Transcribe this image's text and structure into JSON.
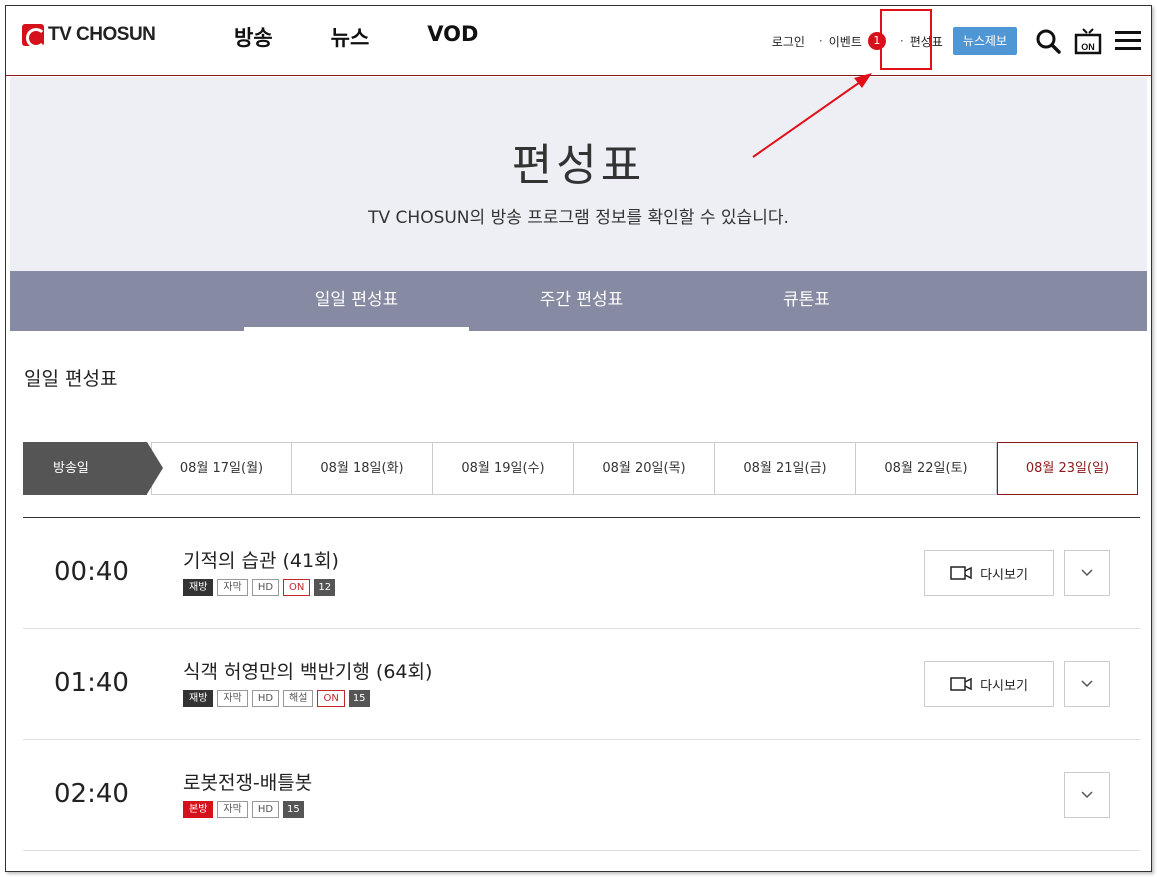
{
  "header": {
    "logo_text": "TV CHOSUN",
    "nav": [
      "방송",
      "뉴스",
      "VOD"
    ],
    "login": "로그인",
    "event": "이벤트",
    "event_count": "1",
    "schedule": "편성표",
    "news_tip": "뉴스제보",
    "on_icon_label": "ON"
  },
  "hero": {
    "title": "편성표",
    "description": "TV CHOSUN의 방송 프로그램 정보를 확인할 수 있습니다."
  },
  "tabs": [
    "일일 편성표",
    "주간 편성표",
    "큐톤표"
  ],
  "section_title": "일일 편성표",
  "datebar": {
    "label": "방송일",
    "dates": [
      "08월 17일(월)",
      "08월 18일(화)",
      "08월 19일(수)",
      "08월 20일(목)",
      "08월 21일(금)",
      "08월 22일(토)",
      "08월 23일(일)"
    ],
    "selected_index": 6
  },
  "programs": [
    {
      "time": "00:40",
      "title": "기적의 습관 (41회)",
      "tags": [
        "재방",
        "자막",
        "HD",
        "ON",
        "12"
      ],
      "replay": "다시보기"
    },
    {
      "time": "01:40",
      "title": "식객 허영만의 백반기행 (64회)",
      "tags": [
        "재방",
        "자막",
        "HD",
        "해설",
        "ON",
        "15"
      ],
      "replay": "다시보기"
    },
    {
      "time": "02:40",
      "title": "로봇전쟁-배틀봇",
      "tags": [
        "본방",
        "자막",
        "HD",
        "15"
      ]
    }
  ],
  "colors": {
    "brand_red": "#d5121b",
    "tab_bg": "#868aa3",
    "hero_bg": "#eeeff4",
    "news_tip": "#4f97d4",
    "annotation": "#e0101a"
  }
}
